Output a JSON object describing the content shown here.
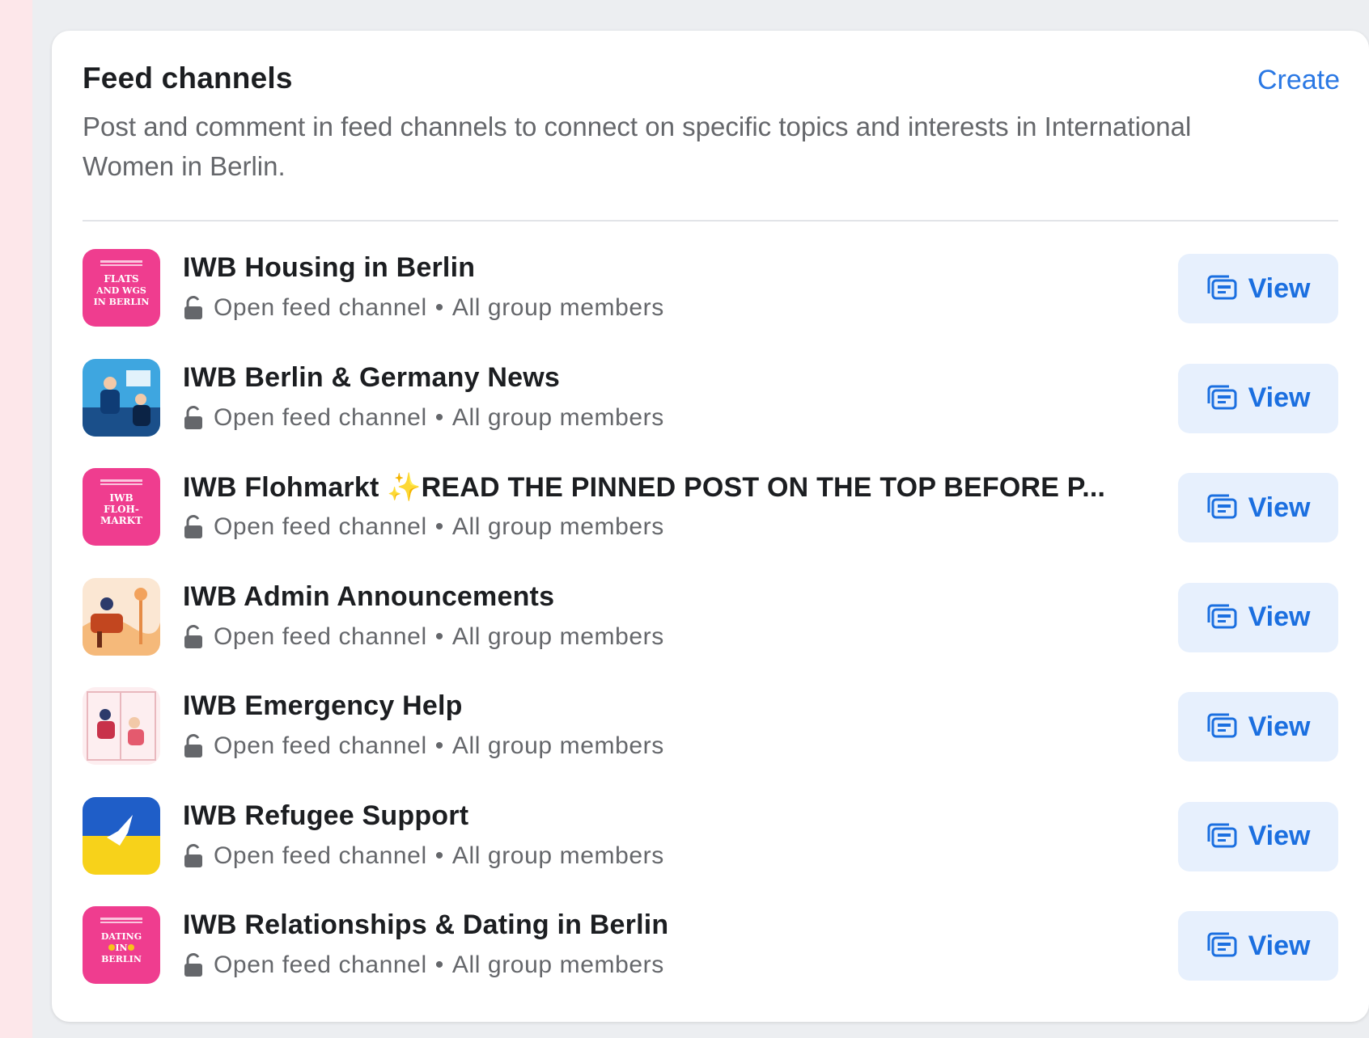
{
  "header": {
    "title": "Feed channels",
    "create_label": "Create",
    "description": "Post and comment in feed channels to connect on specific topics and interests in International Women in Berlin."
  },
  "channels": [
    {
      "title": "IWB Housing in Berlin",
      "privacy": "Open feed channel",
      "audience": "All group members",
      "view_label": "View",
      "thumb_text": [
        "FLATS",
        "AND WGS",
        "IN BERLIN"
      ],
      "thumb_color": "#ef3d8f"
    },
    {
      "title": "IWB Berlin & Germany News",
      "privacy": "Open feed channel",
      "audience": "All group members",
      "view_label": "View",
      "thumb_color": "#3ea6e0"
    },
    {
      "title": "IWB Flohmarkt ✨READ THE PINNED POST ON THE TOP BEFORE P...",
      "privacy": "Open feed channel",
      "audience": "All group members",
      "view_label": "View",
      "thumb_text": [
        "IWB",
        "FLOH-",
        "MARKT"
      ],
      "thumb_color": "#ef3d8f"
    },
    {
      "title": "IWB Admin Announcements",
      "privacy": "Open feed channel",
      "audience": "All group members",
      "view_label": "View",
      "thumb_color": "#f7c99a"
    },
    {
      "title": "IWB Emergency Help",
      "privacy": "Open feed channel",
      "audience": "All group members",
      "view_label": "View",
      "thumb_color": "#fbe3e6"
    },
    {
      "title": "IWB Refugee Support",
      "privacy": "Open feed channel",
      "audience": "All group members",
      "view_label": "View",
      "thumb_color": "#1f5ec8"
    },
    {
      "title": "IWB Relationships & Dating in Berlin",
      "privacy": "Open feed channel",
      "audience": "All group members",
      "view_label": "View",
      "thumb_text": [
        "DATING",
        "IN",
        "BERLIN"
      ],
      "thumb_color": "#ef3d8f"
    }
  ],
  "separator": "•",
  "icons": {
    "lock": "lock-open-icon",
    "view": "feed-view-icon"
  },
  "colors": {
    "accent": "#1b6fe0",
    "link": "#2a78e4",
    "button_bg": "#e7f0fd",
    "secondary_text": "#65676b"
  }
}
